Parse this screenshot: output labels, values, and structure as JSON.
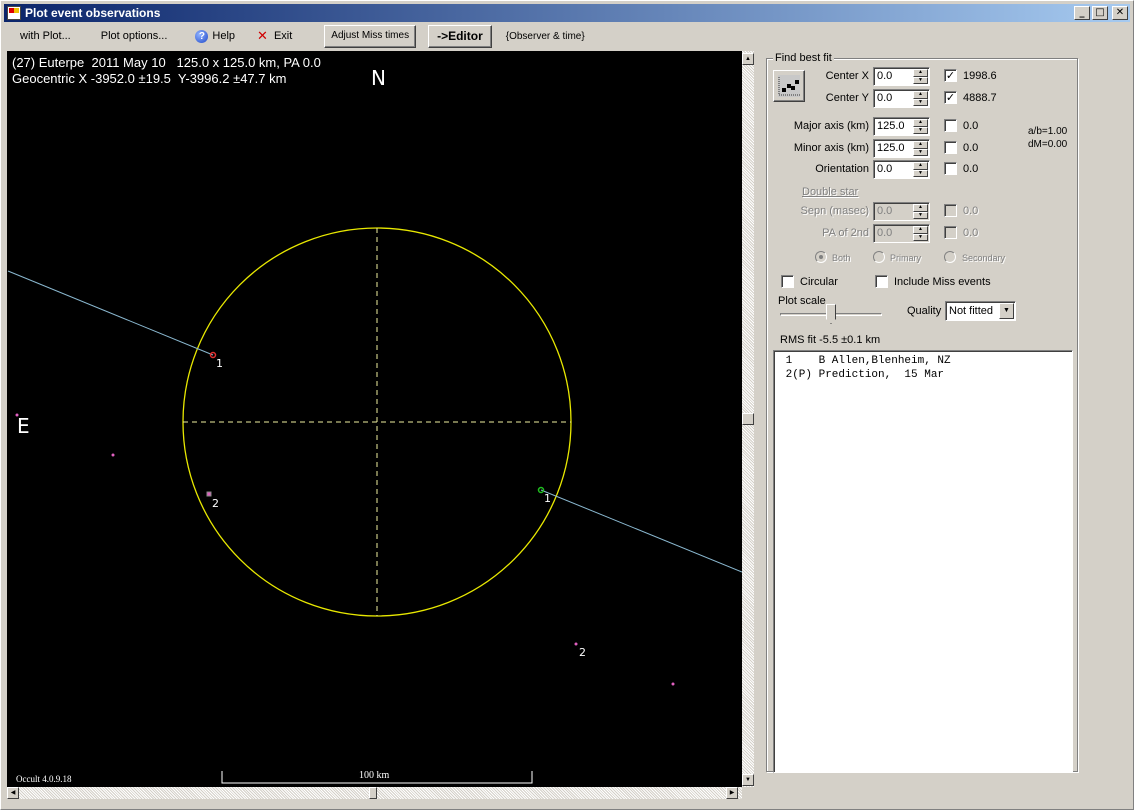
{
  "window": {
    "title": "Plot event observations",
    "controls": {
      "minimize": "_",
      "maximize": "□",
      "close": "✕"
    }
  },
  "menu": {
    "with_plot": "with Plot...",
    "plot_options": "Plot options...",
    "help": "Help",
    "exit": "Exit",
    "adjust_miss": "Adjust Miss times",
    "editor": "->Editor",
    "observer_time": "{Observer & time}"
  },
  "plot": {
    "title": "(27) Euterpe  2011 May 10   125.0 x 125.0 km, PA 0.0",
    "subtitle": "Geocentric X -3952.0 ±19.5  Y-3996.2 ±47.7 km",
    "north": "N",
    "east": "E",
    "version": "Occult 4.0.9.18",
    "scale_bar_label": "100 km",
    "colors": {
      "background": "#000000",
      "ellipse": "#e8e800",
      "axes": "#f0f0a0",
      "chord": "#8ab8d0",
      "disappear": "#e03030",
      "reappear": "#20c020",
      "miss": "#e060c0",
      "label": "#ffffff"
    },
    "ellipse": {
      "major_km": 125.0,
      "minor_km": 125.0,
      "pa_deg": 0.0
    },
    "observations": [
      {
        "id": "1",
        "type": "chord",
        "event": "disappear"
      },
      {
        "id": "1",
        "type": "chord",
        "event": "reappear"
      },
      {
        "id": "2",
        "type": "prediction",
        "event": "miss"
      },
      {
        "id": "2",
        "type": "prediction",
        "event": "miss"
      }
    ]
  },
  "fit": {
    "group_label": "Find best fit",
    "fit_button_icon": "fit-chart-icon",
    "rows": [
      {
        "label": "Center X",
        "value": "0.0",
        "checked": true,
        "result": "1998.6",
        "enabled": true
      },
      {
        "label": "Center Y",
        "value": "0.0",
        "checked": true,
        "result": "4888.7",
        "enabled": true
      },
      {
        "label": "Major axis (km)",
        "value": "125.0",
        "checked": false,
        "result": "0.0",
        "enabled": true
      },
      {
        "label": "Minor axis (km)",
        "value": "125.0",
        "checked": false,
        "result": "0.0",
        "enabled": true
      },
      {
        "label": "Orientation",
        "value": "0.0",
        "checked": false,
        "result": "0.0",
        "enabled": true
      }
    ],
    "ratio": "a/b=1.00",
    "dm": "dM=0.00",
    "double_star": {
      "label": "Double star",
      "rows": [
        {
          "label": "Sepn (masec)",
          "value": "0.0",
          "checked": false,
          "result": "0.0"
        },
        {
          "label": "PA of 2nd",
          "value": "0.0",
          "checked": false,
          "result": "0.0"
        }
      ],
      "radios": [
        {
          "label": "Both",
          "selected": true
        },
        {
          "label": "Primary",
          "selected": false
        },
        {
          "label": "Secondary",
          "selected": false
        }
      ]
    },
    "circular_label": "Circular",
    "circular_checked": false,
    "include_miss_label": "Include Miss events",
    "include_miss_checked": false,
    "plot_scale_label": "Plot scale",
    "plot_scale_value": 0.5,
    "quality_label": "Quality",
    "quality_value": "Not fitted",
    "rms_fit": "RMS fit -5.5 ±0.1 km"
  },
  "observer_list": [
    " 1    B Allen,Blenheim, NZ",
    " 2(P) Prediction,  15 Mar"
  ]
}
